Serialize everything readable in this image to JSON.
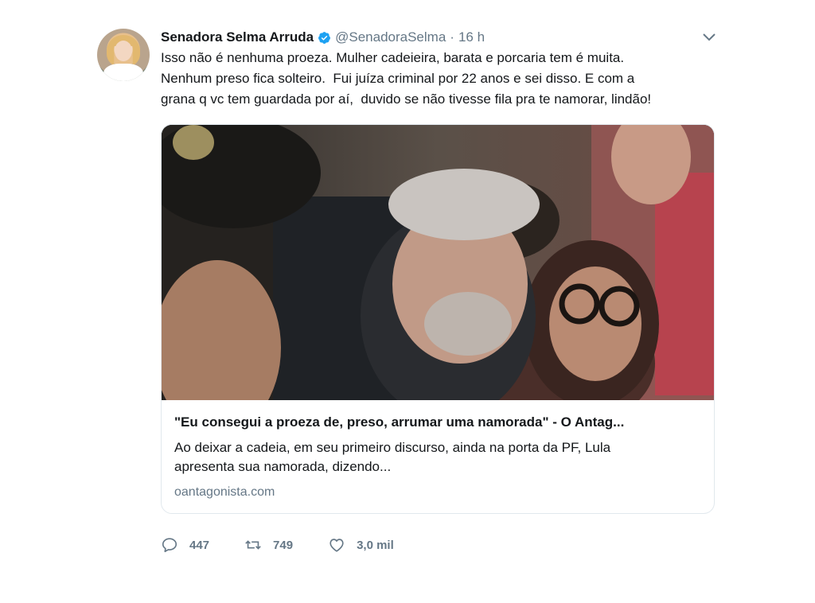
{
  "tweet": {
    "author_name": "Senadora Selma Arruda",
    "author_handle": "@SenadoraSelma",
    "separator": "·",
    "time": "16 h",
    "text_lines": [
      "Isso não é nenhuma proeza. Mulher cadeieira, barata e porcaria tem é muita.",
      "Nenhum preso fica solteiro.  Fui juíza criminal por 22 anos e sei disso. E com a",
      "grana q vc tem guardada por aí,  duvido se não tivesse fila pra te namorar, lindão!"
    ]
  },
  "card": {
    "title": "\"Eu consegui a proeza de, preso, arrumar uma namorada\" - O Antag...",
    "description_lines": [
      "Ao deixar a cadeia, em seu primeiro discurso, ainda na porta da PF, Lula",
      "apresenta sua namorada, dizendo..."
    ],
    "domain": "oantagonista.com"
  },
  "actions": {
    "replies": "447",
    "retweets": "749",
    "likes": "3,0 mil"
  },
  "icons": {
    "verified": "verified-badge-icon",
    "caret": "chevron-down-icon",
    "reply": "reply-icon",
    "retweet": "retweet-icon",
    "like": "heart-icon"
  },
  "colors": {
    "verified_blue": "#1da1f2",
    "secondary_text": "#657786",
    "primary_text": "#14171a",
    "card_border": "#e1e8ed"
  }
}
